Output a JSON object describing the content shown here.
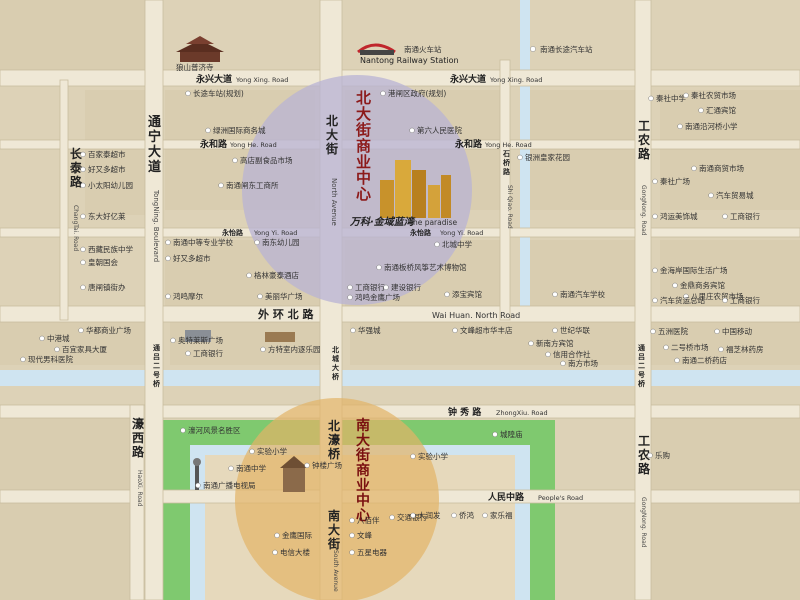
{
  "colors": {
    "land": "#ddd2b7",
    "block": "#d6c9a8",
    "road": "#ebe4d3",
    "river": "#cfe4f1",
    "green": "#7fc96f",
    "north_circle": "#b8b3d4",
    "south_circle": "#e2b466",
    "poi_dot": "#ffffff",
    "label_red": "#8c1a1a"
  },
  "landmarks": {
    "temple": "狼山普济寺",
    "railway_cn": "南通火车站",
    "railway_en": "Nantong Railway Station",
    "long_distance_bus": "南通长途汽车站"
  },
  "roads": {
    "yongxing": {
      "cn": "永兴大道",
      "en": "Yong Xing. Road"
    },
    "yongxing_right": {
      "cn": "永兴大道",
      "en": "Yong Xing. Road"
    },
    "yonghe": {
      "cn": "永和路",
      "en": "Yong He. Road"
    },
    "yonghe_right": {
      "cn": "永和路",
      "en": "Yong He. Road"
    },
    "yongyi": {
      "cn": "永怡路",
      "en": "Yong Yi. Road"
    },
    "yongyi_right": {
      "cn": "永怡路",
      "en": "Yong Yi. Road"
    },
    "waihuan": {
      "cn": "外  环  北  路",
      "en": "Wai Huan. North Road"
    },
    "zhongxiu": {
      "cn": "钟 秀 路",
      "en": "ZhongXiu. Road"
    },
    "renmin": {
      "cn": "人民中路",
      "en": "People's Road"
    },
    "changtai": {
      "cn": "长泰路",
      "en": "ChangTai. Road"
    },
    "tongning": {
      "cn": "通宁大道",
      "en": "TongNing. Boulevard"
    },
    "north_ave": {
      "cn": "北大街",
      "en": "North Avenue"
    },
    "shiqiao": {
      "cn": "石桥路",
      "en": "Shi Qiao. Road"
    },
    "gongnong_n": {
      "cn": "工农路",
      "en": "GongNong. Road"
    },
    "gongnong_s": {
      "cn": "工农路",
      "en": "GongNong. Road"
    },
    "haoxi": {
      "cn": "濠西路",
      "en": "HaoXi. Road"
    },
    "tongl_left": "通吕二号桥",
    "tongl_right": "通吕二号桥",
    "beicheng": "北城大桥",
    "beihao": "北濠桥",
    "south_ave": {
      "cn": "南大街",
      "en": "South Avenue"
    }
  },
  "districts": {
    "north": "北大街商业中心",
    "south": "南大街商业中心"
  },
  "project": {
    "cn": "万科·金域蓝湾",
    "en": "the paradise"
  },
  "pois": {
    "yongxing_station": "长途车站(规划)",
    "gangzha_gov": "港闸区政府(规划)",
    "lvzhou": "绿洲国际商务城",
    "sixth_hospital": "第六人民医院",
    "gaodian": "高店副食品市场",
    "nanhuadong": "南通闸东工商所",
    "yinzhou": "银洲皇家花园",
    "baijiahui": "百家泰超市",
    "haoyou_duo": "好又多超市",
    "xiaomu": "小太阳幼儿园",
    "dongda": "东大好亿莱",
    "xiaoqi": "西藏民族中学",
    "huangchao": "皇朝国会",
    "tanghu": "唐闸镇街办",
    "zhongxue": "南通中等专业学校",
    "haoyouduo2": "好又多超市",
    "hongming": "鸿鸣摩尔",
    "nandong_kind": "南东幼儿园",
    "gelin": "格林豪泰酒店",
    "meili": "美丽华广场",
    "beicheng_mid": "北城中学",
    "banqiao": "南通板桥风筝艺术博物馆",
    "gongshang": "工商银行",
    "jianshe": "建设银行",
    "hongsheng": "鸿鸣金鹰广场",
    "tiansheng": "添宝宾馆",
    "qinshe": "秦社中学",
    "qinshe_mkt": "秦社农贸市场",
    "huitong": "汇通宾馆",
    "yonghe_pri": "南通沿河桥小学",
    "nantong_shop": "南通商贸市场",
    "qinshe_sq": "秦社广场",
    "auto_trade": "汽车贸易城",
    "hongyun": "鸿运美饰城",
    "icbc_r": "工商银行",
    "jinhai": "金海岸国际生活广场",
    "jinding": "金鼎商务宾馆",
    "bali": "八里庄农贸市场",
    "auto_school": "南通汽车学校",
    "auto_parts": "汽车货运总站",
    "icbc_r2": "工商银行",
    "zhonggang": "中港城",
    "huadu": "华都商业广场",
    "baiyi": "百宜家具大厦",
    "xiandai": "现代男科医院",
    "aote": "奥特莱斯广场",
    "icbc_l": "工商银行",
    "fangte": "方特室内逐乐园",
    "huaqiang": "华强城",
    "wenfeng": "文峰超市华丰店",
    "shiji": "世纪华联",
    "xinnan": "新南方宾馆",
    "xinyong": "信用合作社",
    "nanfang_mkt": "南方市场",
    "wuzhou": "五洲医院",
    "zhongyi": "中国移动",
    "erhao": "二号桥市场",
    "fuxing": "福芝林药房",
    "nantong_pharm": "南通二桥药店",
    "haohe_scenic": "濠河风景名胜区",
    "chenghuang": "城隍庙",
    "shiyan_pri": "实验小学",
    "shiyan_pri2": "实验小学",
    "nantong_mid": "南通中学",
    "zhonglou": "钟楼广场",
    "tv_tower": "南通广播电视局",
    "lefu": "乐购",
    "bajiaban": "八佰伴",
    "wenfeng2": "文峰",
    "wuxing": "五星电器",
    "jiaotong": "交通银行",
    "dara": "大润发",
    "qiaohong": "侨鸿",
    "jiale": "家乐福",
    "jinying": "金鹰国际",
    "dianxin": "电信大楼"
  }
}
